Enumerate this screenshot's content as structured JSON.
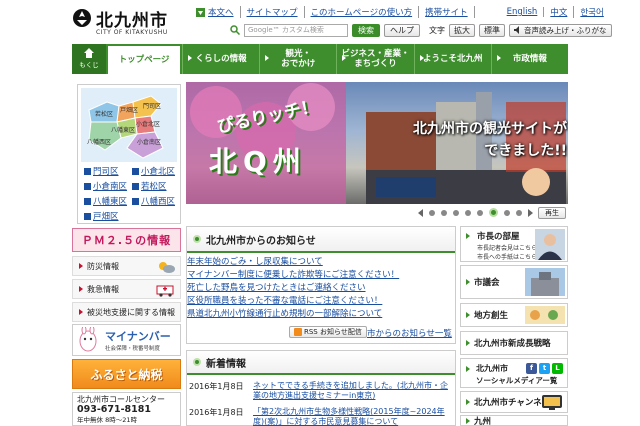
{
  "header": {
    "logo_name": "北九州市",
    "logo_en": "CITY OF KITAKYUSHU",
    "top_links": [
      "本文へ",
      "サイトマップ",
      "このホームページの使い方",
      "携帯サイト",
      "English",
      "中文",
      "한국어"
    ],
    "search_placeholder": "Google™ カスタム検索",
    "search_button": "検索",
    "help_button": "ヘルプ",
    "text_label": "文字",
    "size_large": "拡大",
    "size_normal": "標準",
    "read_aloud": "音声読み上げ・ふりがな"
  },
  "nav": {
    "mokuji": "もくじ",
    "items": [
      "トップページ",
      "くらしの情報",
      "観光・\nおでかけ",
      "ビジネス・産業・\nまちづくり",
      "ようこそ北九州",
      "市政情報"
    ]
  },
  "map": {
    "labels": [
      "若松区",
      "戸畑区",
      "門司区",
      "小倉北区",
      "八幡東区",
      "八幡西区",
      "小倉南区"
    ],
    "wards": [
      "門司区",
      "小倉北区",
      "小倉南区",
      "若松区",
      "八幡東区",
      "八幡西区",
      "戸畑区"
    ]
  },
  "left": {
    "pm25": "ＰＭ２.５の情報",
    "items": [
      "防災情報",
      "救急情報",
      "被災地支援に関する情報"
    ],
    "mynumber_title": "マイナンバー",
    "mynumber_sub": "社会保障・税番号制度",
    "furusato": "ふるさと納税",
    "callcenter_name": "北九州市コールセンター",
    "callcenter_tel": "093-671-8181",
    "callcenter_hours": "年中無休 8時～21時"
  },
  "hero": {
    "logo_line1": "ぴるりッチ！",
    "logo_line2": "北Q州",
    "caption": "北九州市の観光サイトが\nできました!!",
    "play": "再生",
    "slide_count": 8,
    "active_slide": 6
  },
  "news": {
    "title": "北九州市からのお知らせ",
    "items": [
      "年末年始のごみ・し尿収集について",
      "マイナンバー制度に便乗した詐欺等にご注意ください！",
      "死亡した野鳥を見つけたときはご連絡ください",
      "区役所職員を装った不審な電話にご注意ください！",
      "県道北九州小竹線通行止め規制の一部解除について"
    ],
    "rss": "RSS お知らせ配信",
    "more": "市からのお知らせ一覧"
  },
  "whats_new": {
    "title": "新着情報",
    "rows": [
      {
        "date": "2016年1月8日",
        "text": "ネットでできる手続きを追加しました。(北九州市・企業の地方進出支援セミナーin東京)"
      },
      {
        "date": "2016年1月8日",
        "text": "「第2次北九州市生物多様性戦略(2015年度~2024年度)(案)」に対する市民意見募集について"
      }
    ]
  },
  "right": {
    "mayor_title": "市長の部屋",
    "mayor_line1": "市長記者会見はこちら",
    "mayor_line2": "市長への手紙はこちら",
    "gikai": "市議会",
    "chiho": "地方創生",
    "senryaku": "北九州市新成長戦略",
    "social_line1": "北九州市",
    "social_line2": "ソーシャルメディアー覧",
    "channel": "北九州市チャンネル",
    "kyushu": "九州"
  },
  "colors": {
    "brand_green": "#3e8e2d",
    "link_blue": "#1a4fa0",
    "pm25_pink": "#c2185b",
    "furusato_orange": "#f08a1c"
  }
}
